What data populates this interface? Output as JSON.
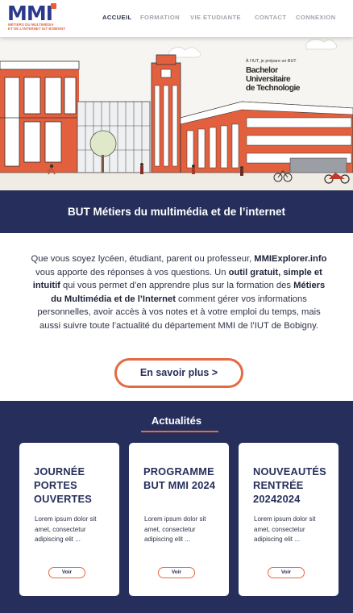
{
  "logo": {
    "brand": "MMI",
    "tagline_1": "MÉTIERS DU MULTIMÉDIA",
    "tagline_2": "ET DE L'INTERNET IUT BOBIGNY"
  },
  "nav": {
    "items": [
      {
        "label": "ACCUEIL",
        "active": true
      },
      {
        "label": "FORMATION",
        "active": false
      },
      {
        "label": "VIE ETUDIANTE",
        "active": false
      },
      {
        "label": "CONTACT",
        "active": false
      },
      {
        "label": "CONNEXION",
        "active": false
      }
    ]
  },
  "hero": {
    "caption_small": "À l'IUT, je prépare un BUT",
    "caption_line_1": "Bachelor",
    "caption_line_2": "Universitaire",
    "caption_line_3": "de Technologie"
  },
  "banner": {
    "title": "BUT Métiers du multimédia et de l’internet"
  },
  "intro": {
    "p1": "Que vous soyez lycéen, étudiant, parent ou professeur,",
    "b1": "MMIExplorer.info",
    "p2": " vous apporte des réponses à vos questions. Un ",
    "b2": "outil gratuit, simple et intuitif",
    "p3": " qui vous permet d’en apprendre plus sur la formation des ",
    "b3": "Métiers du Multimédia et de l’Internet",
    "p4": " comment gérer vos informations personnelles, avoir accès à vos notes et à votre emploi du temps, mais aussi suivre toute l’actualité du département MMI de l’IUT de Bobigny.",
    "button": "En savoir plus >"
  },
  "news": {
    "title": "Actualités",
    "cards": [
      {
        "title": "JOURNÉE PORTES OUVERTES",
        "text": "Lorem ipsum dolor sit amet, consectetur adipiscing elit ...",
        "button": "Voir"
      },
      {
        "title": "PROGRAMME BUT MMI 2024",
        "text": "Lorem ipsum dolor sit amet, consectetur adipiscing elit ...",
        "button": "Voir"
      },
      {
        "title": "NOUVEAUTÉS RENTRÉE 20242024",
        "text": "Lorem ipsum dolor sit amet, consectetur adipiscing elit ...",
        "button": "Voir"
      }
    ]
  },
  "colors": {
    "navy": "#262f5b",
    "accent": "#e46a42",
    "logo_blue": "#2b3a8c"
  }
}
